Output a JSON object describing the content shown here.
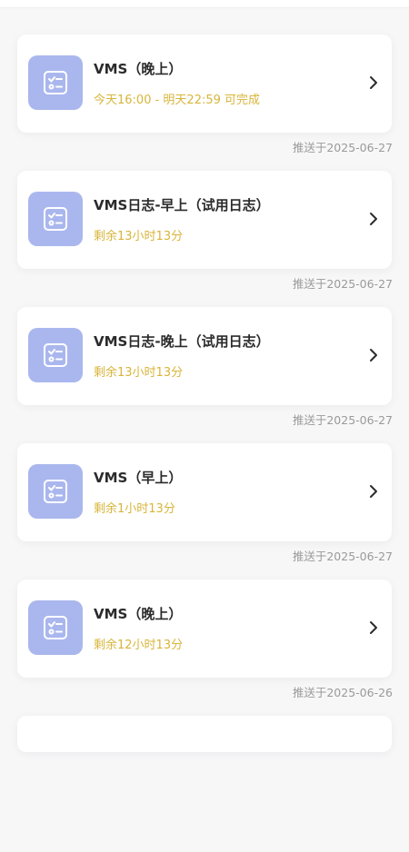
{
  "tasks": [
    {
      "title": "VMS（晚上）",
      "subtitle": "今天16:00 - 明天22:59 可完成",
      "pushed": "推送于2025-06-27"
    },
    {
      "title": "VMS日志-早上（试用日志）",
      "subtitle": "剩余13小时13分",
      "pushed": "推送于2025-06-27"
    },
    {
      "title": "VMS日志-晚上（试用日志）",
      "subtitle": "剩余13小时13分",
      "pushed": "推送于2025-06-27"
    },
    {
      "title": "VMS（早上）",
      "subtitle": "剩余1小时13分",
      "pushed": "推送于2025-06-27"
    },
    {
      "title": "VMS（晚上）",
      "subtitle": "剩余12小时13分",
      "pushed": "推送于2025-06-26"
    }
  ],
  "colors": {
    "icon_bg": "#aab7ee",
    "subtitle": "#d8b53a",
    "meta": "#9a9a9a"
  },
  "icons": {
    "task": "checklist-icon",
    "arrow": "chevron-right-icon"
  }
}
